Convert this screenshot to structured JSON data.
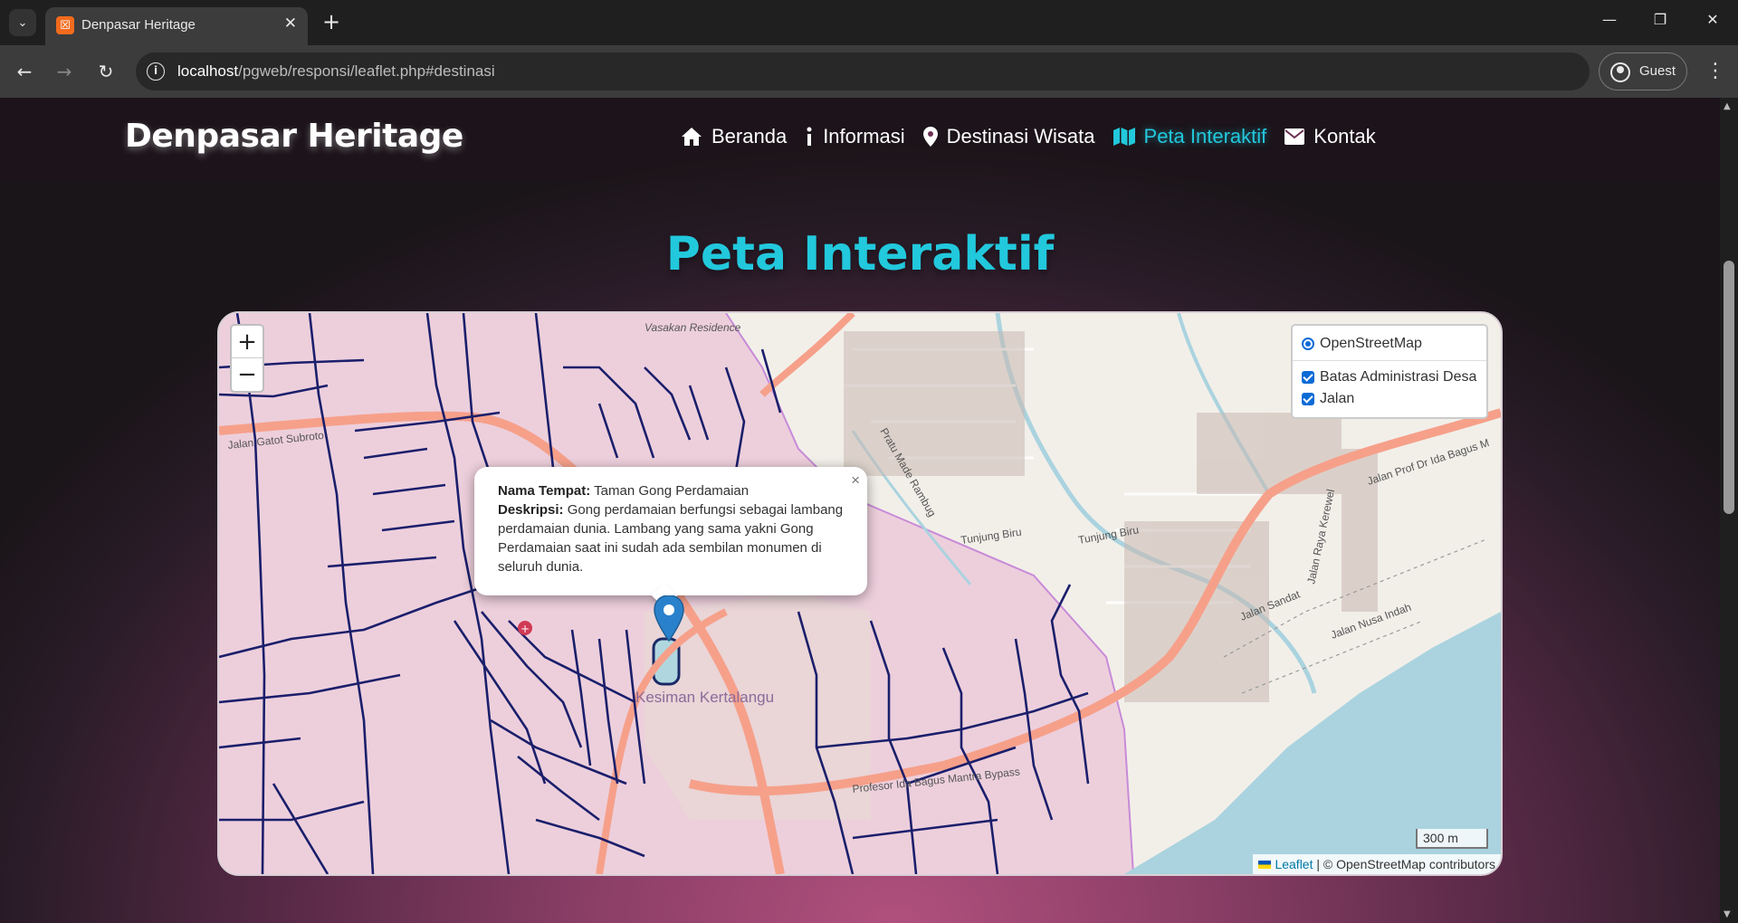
{
  "browser": {
    "tab_title": "Denpasar Heritage",
    "url_host": "localhost",
    "url_path": "/pgweb/responsi/leaflet.php#destinasi",
    "profile_label": "Guest"
  },
  "site": {
    "brand": "Denpasar Heritage",
    "nav": [
      {
        "label": "Beranda",
        "icon": "home-icon"
      },
      {
        "label": "Informasi",
        "icon": "info-icon"
      },
      {
        "label": "Destinasi Wisata",
        "icon": "map-marker-icon"
      },
      {
        "label": "Peta Interaktif",
        "icon": "map-icon",
        "active": true
      },
      {
        "label": "Kontak",
        "icon": "envelope-icon"
      }
    ],
    "accent_color": "#22c8dc",
    "heading": "Peta Interaktif"
  },
  "map": {
    "zoom_in": "+",
    "zoom_out": "−",
    "layers": {
      "base": "OpenStreetMap",
      "overlays": [
        "Batas Administrasi Desa",
        "Jalan"
      ]
    },
    "popup": {
      "name_label": "Nama Tempat:",
      "name_value": "Taman Gong Perdamaian",
      "desc_label": "Deskripsi:",
      "desc_value": "Gong perdamaian berfungsi sebagai lambang perdamaian dunia. Lambang yang sama yakni Gong Perdamaian saat ini sudah ada sembilan monumen di seluruh dunia.",
      "close": "×"
    },
    "scale": "300 m",
    "attribution_link": "Leaflet",
    "attribution_text": "| © OpenStreetMap contributors",
    "place_labels": {
      "village": "Kesiman Kertalangu",
      "bypass": "Profesor Ida Bagus Mantra Bypass",
      "east_road": "Jalan Prof Dr Ida Bagus M",
      "tunjung1": "Tunjung Biru",
      "tunjung2": "Tunjung Biru",
      "jalan_gatot": "Jalan Gatot Subroto",
      "jalan_sandat": "Jalan Sandat",
      "jalan_nusa_indah": "Jalan Nusa Indah",
      "jalan_raya_kerewel": "Jalan Raya Kerewel",
      "pratu": "Pratu Made Rambug",
      "vasakan": "Vasakan Residence"
    }
  }
}
